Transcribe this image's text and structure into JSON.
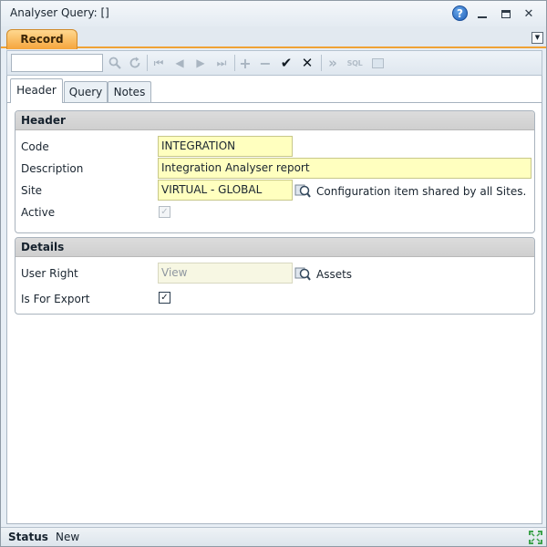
{
  "window": {
    "title": "Analyser Query: []",
    "help_symbol": "?",
    "close_symbol": "✕"
  },
  "record_tab": {
    "label": "Record",
    "dropdown_symbol": "▼"
  },
  "toolbar": {
    "search_value": "",
    "sql_label": "SQL",
    "first_symbol": "⏮",
    "prev_symbol": "◀",
    "next_symbol": "▶",
    "last_symbol": "⏭",
    "add_symbol": "+",
    "remove_symbol": "−",
    "confirm_symbol": "✔",
    "cancel_symbol": "✕",
    "forward_symbol": "»"
  },
  "tabs": [
    {
      "label": "Header"
    },
    {
      "label": "Query"
    },
    {
      "label": "Notes"
    }
  ],
  "header_section": {
    "title": "Header",
    "code": {
      "label": "Code",
      "value": "INTEGRATION"
    },
    "description": {
      "label": "Description",
      "value": "Integration Analyser report"
    },
    "site": {
      "label": "Site",
      "value": "VIRTUAL - GLOBAL",
      "note": "Configuration item shared by all Sites."
    },
    "active": {
      "label": "Active",
      "check_symbol": "✓"
    }
  },
  "details_section": {
    "title": "Details",
    "user_right": {
      "label": "User Right",
      "placeholder": "View",
      "note": "Assets"
    },
    "is_for_export": {
      "label": "Is For Export",
      "check_symbol": "✓"
    }
  },
  "status": {
    "label": "Status",
    "value": "New"
  },
  "colors": {
    "record_tab": "#f5a53c",
    "field_bg": "#ffffbf",
    "section_header": "#d4d4d4",
    "help_icon": "#2f78d0"
  },
  "icons": [
    "help-icon",
    "minimize-icon",
    "maximize-icon",
    "close-icon",
    "search-icon",
    "refresh-icon",
    "lookup-icon",
    "resize-icon"
  ]
}
